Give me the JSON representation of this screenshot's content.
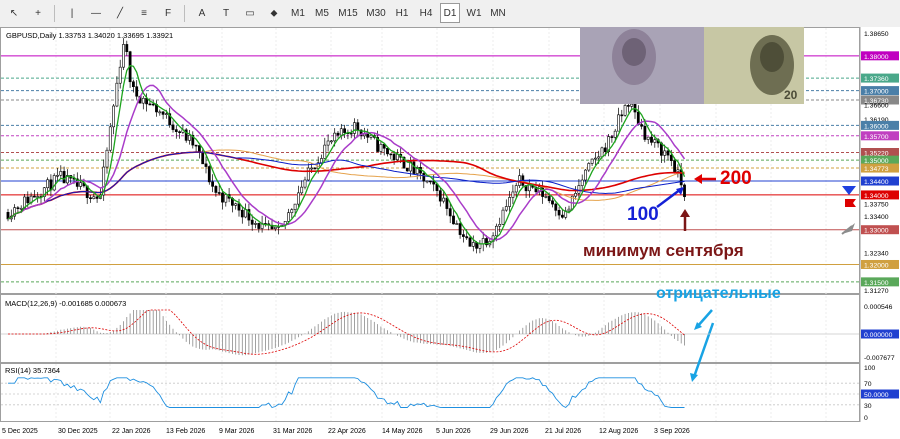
{
  "toolbar": {
    "tools": [
      {
        "name": "cursor-tool",
        "glyph": "↖"
      },
      {
        "name": "crosshair-tool",
        "glyph": "+"
      },
      {
        "name": "vertical-line-tool",
        "glyph": "|"
      },
      {
        "name": "horizontal-line-tool",
        "glyph": "—"
      },
      {
        "name": "trendline-tool",
        "glyph": "╱"
      },
      {
        "name": "equidistant-channel-tool",
        "glyph": "≡"
      },
      {
        "name": "fibonacci-tool",
        "glyph": "F"
      },
      {
        "name": "text-tool",
        "glyph": "A"
      },
      {
        "name": "text-label-tool",
        "glyph": "T"
      },
      {
        "name": "arrows-tool",
        "glyph": "▭"
      },
      {
        "name": "shapes-tool",
        "glyph": "⬥"
      }
    ],
    "timeframes": [
      "M1",
      "M5",
      "M15",
      "M30",
      "H1",
      "H4",
      "D1",
      "W1",
      "MN"
    ],
    "active_timeframe": "D1"
  },
  "main": {
    "header": "GBPUSD,Daily  1.33753 1.34020 1.33695 1.33921",
    "price_levels": [
      "1.38650",
      "1.38000",
      "1.37360",
      "1.37000",
      "1.36730",
      "1.36600",
      "1.36190",
      "1.36000",
      "1.35700",
      "1.35220",
      "1.35000",
      "1.34773",
      "1.34400",
      "1.34000",
      "1.33750",
      "1.33400",
      "1.33000",
      "1.32340",
      "1.32000",
      "1.31500",
      "1.31270"
    ],
    "annotations": {
      "label_200": "200",
      "label_100": "100",
      "label_min": "минимум сентября",
      "label_negative": "отрицательные"
    }
  },
  "macd": {
    "header": "MACD(12,26,9) -0.001685 0.000673",
    "levels": [
      "0.000546",
      "0.000000",
      "-0.007677"
    ]
  },
  "rsi": {
    "header": "RSI(14) 35.7364",
    "levels": [
      "100",
      "70",
      "50.0000",
      "30",
      "0"
    ]
  },
  "time_axis": [
    "5 Dec 2025",
    "30 Dec 2025",
    "22 Jan 2026",
    "13 Feb 2026",
    "9 Mar 2026",
    "31 Mar 2026",
    "22 Apr 2026",
    "14 May 2026",
    "5 Jun 2026",
    "29 Jun 2026",
    "21 Jul 2026",
    "12 Aug 2026",
    "3 Sep 2026"
  ],
  "banknotes": {
    "top": "20",
    "bottom": "20"
  },
  "colors": {
    "candle": "#000000",
    "ma_red": "#dd0000",
    "ma_blue": "#0a1ec8",
    "ma_green": "#1da41d",
    "ma_violet": "#a93cc9",
    "ma_orange": "#e5a24b",
    "annot_red": "#e00000",
    "annot_blue": "#1521d6",
    "annot_dark": "#7b1616",
    "annot_cyan": "#18a3e4"
  }
}
